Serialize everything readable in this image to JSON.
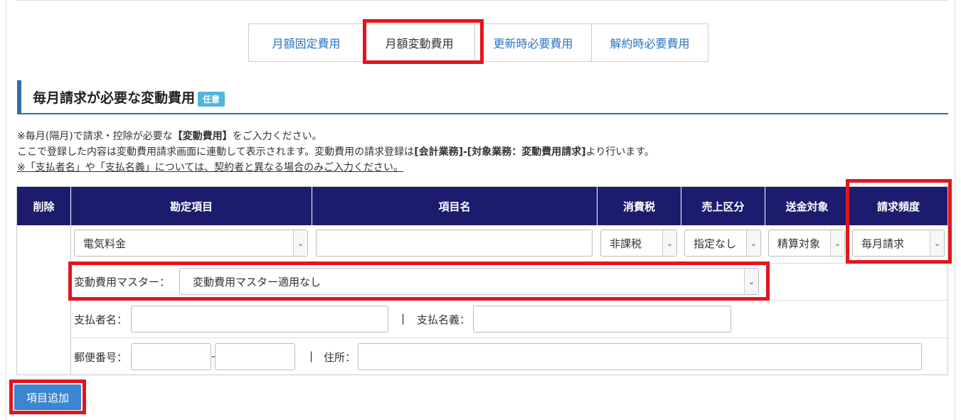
{
  "tabs": [
    "月額固定費用",
    "月額変動費用",
    "更新時必要費用",
    "解約時必要費用"
  ],
  "section": {
    "title": "毎月請求が必要な変動費用",
    "badge": "任意"
  },
  "notes": {
    "line1_a": "※毎月(隔月)で請求・控除が必要な",
    "line1_b": "【変動費用】",
    "line1_c": "をご入力ください。",
    "line2_a": "ここで登録した内容は変動費用請求画面に連動して表示されます。変動費用の請求登録は",
    "line2_b": "[会計業務]-[対象業務：変動費用請求]",
    "line2_c": "より行います。",
    "line3": "※「支払者名」や「支払名義」については、契約者と異なる場合のみご入力ください。"
  },
  "table": {
    "headers": [
      "削除",
      "勘定項目",
      "項目名",
      "消費税",
      "売上区分",
      "送金対象",
      "請求頻度"
    ],
    "row": {
      "account_item": "電気料金",
      "item_name": "",
      "tax": "非課税",
      "sales_category": "指定なし",
      "remit_target": "精算対象",
      "billing_frequency": "毎月請求"
    },
    "master_label": "変動費用マスター：",
    "master_value": "変動費用マスター適用なし",
    "payer_label": "支払者名：",
    "separator": "|",
    "payer_name_label": "支払名義：",
    "zip_label": "郵便番号：",
    "zip_dash": "-",
    "address_label": "住所："
  },
  "add_button": "項目追加",
  "colors": {
    "header_bg": "#1c1c6e",
    "highlight": "#e3141f",
    "accent": "#3a86d0",
    "link": "#2a74c0"
  }
}
